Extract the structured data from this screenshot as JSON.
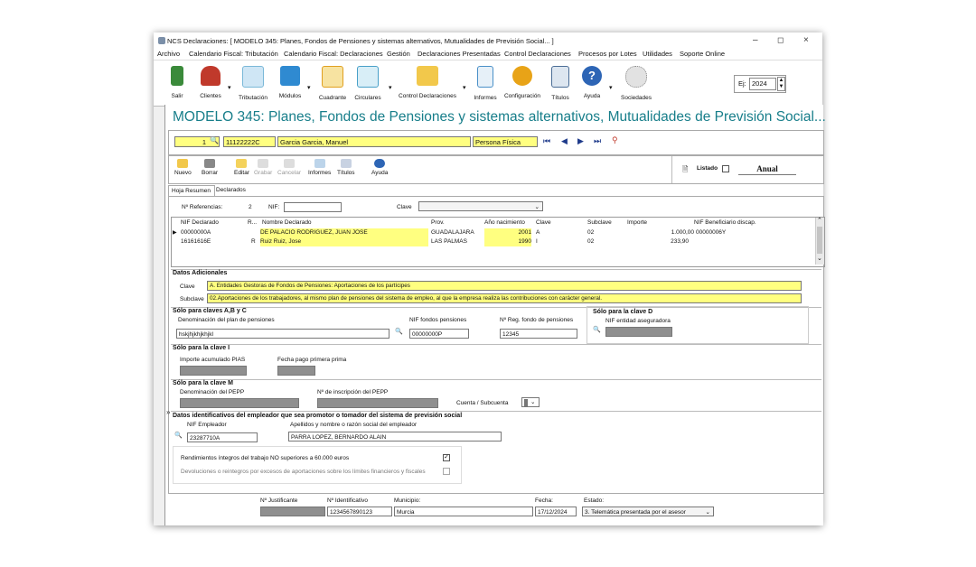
{
  "window": {
    "title": "NCS Declaraciones: [ MODELO 345: Planes, Fondos de Pensiones y sistemas alternativos, Mutualidades de Previsión Social... ]",
    "controls": [
      "–",
      "◻",
      "×"
    ]
  },
  "menu": [
    "Archivo",
    "Calendario Fiscal: Tributación",
    "Calendario Fiscal: Declaraciones",
    "Gestión",
    "Declaraciones Presentadas",
    "Control Declaraciones",
    "Procesos por Lotes",
    "Utilidades",
    "Soporte Online"
  ],
  "toolbar": {
    "items": [
      {
        "label": "Salir",
        "icon": "exit-icon",
        "color": "#3a8a3a"
      },
      {
        "label": "Clientes",
        "icon": "clients-icon",
        "color": "#c0392b"
      },
      {
        "label": "Tributación",
        "icon": "tax-icon",
        "color": "#7ab8d8"
      },
      {
        "label": "Módulos",
        "icon": "modules-icon",
        "color": "#2f8ad1"
      },
      {
        "label": "Cuadrante",
        "icon": "grid-icon",
        "color": "#e0a020"
      },
      {
        "label": "Circulares",
        "icon": "circulars-icon",
        "color": "#48a0c8"
      },
      {
        "label": "Control Declaraciones",
        "icon": "folder-icon",
        "color": "#f2c84b"
      },
      {
        "label": "Informes",
        "icon": "reports-icon",
        "color": "#4a90c8"
      },
      {
        "label": "Configuración",
        "icon": "gear-icon",
        "color": "#e8a317"
      },
      {
        "label": "Títulos",
        "icon": "titles-icon",
        "color": "#4b6d96"
      },
      {
        "label": "Ayuda",
        "icon": "help-icon",
        "color": "#2d65b5"
      },
      {
        "label": "Sociedades",
        "icon": "companies-icon",
        "color": "#888888"
      }
    ],
    "year_label": "Ej:",
    "year_value": "2024"
  },
  "heading": "MODELO 345: Planes, Fondos de Pensiones y sistemas alternativos, Mutualidades de Previsión Social...",
  "client": {
    "number": "1",
    "nif": "11122222C",
    "name": "Garcia Garcia, Manuel",
    "type": "Persona Física"
  },
  "subtoolbar": {
    "items": [
      "Nuevo",
      "Borrar",
      "Editar",
      "Grabar",
      "Cancelar",
      "Informes",
      "Títulos",
      "Ayuda"
    ],
    "listado_label": "Listado",
    "period": "Anual"
  },
  "tabs": [
    "Hoja Resumen",
    "Declarados"
  ],
  "filters": {
    "references_label": "Nº Referencias:",
    "references_count": "2",
    "nif_label": "NIF:",
    "clave_label": "Clave"
  },
  "table": {
    "headers": [
      "NIF Declarado",
      "R...",
      "Nombre Declarado",
      "Prov.",
      "Año nacimiento",
      "Clave",
      "Subclave",
      "Importe",
      "NIF Beneficiario discap."
    ],
    "rows": [
      {
        "nif": "00000000A",
        "r": "",
        "name": "DE PALACIO RODRIGUEZ, JUAN JOSE",
        "prov": "GUADALAJARA",
        "year": "2001",
        "clave": "A",
        "subclave": "02",
        "importe": "1.000,00",
        "nif_benef": "00000006Y"
      },
      {
        "nif": "16161616E",
        "r": "R",
        "name": "Ruiz Ruiz, Jose",
        "prov": "LAS PALMAS",
        "year": "1990",
        "clave": "I",
        "subclave": "02",
        "importe": "233,90",
        "nif_benef": ""
      }
    ]
  },
  "datos_adicionales": {
    "title": "Datos Adicionales",
    "clave_label": "Clave",
    "clave_value": "A. Entidades Gestoras de Fondos de Pensiones: Aportaciones de los partícipes",
    "subclave_label": "Subclave",
    "subclave_value": "02.Aportaciones de los trabajadores, al mismo plan de pensiones del sistema de empleo, al que la empresa realiza las contribuciones con carácter general."
  },
  "claves_abc": {
    "title": "Sólo para claves A,B y C",
    "plan_label": "Denominación del plan de pensiones",
    "plan_value": "hskjhjkhjkhjkl",
    "nif_fondos_label": "NIF fondos pensiones",
    "nif_fondos_value": "00000000P",
    "reg_label": "Nº Reg. fondo de pensiones",
    "reg_value": "12345"
  },
  "clave_d": {
    "title": "Sólo para la clave D",
    "nif_label": "NIF entidad aseguradora"
  },
  "clave_i": {
    "title": "Sólo para la clave I",
    "importe_label": "Importe acumulado PIAS",
    "fecha_label": "Fecha pago primera prima"
  },
  "clave_m": {
    "title": "Sólo para la clave M",
    "pepp_label": "Denominación del PEPP",
    "inscripcion_label": "Nº de inscripción del PEPP",
    "cuenta_label": "Cuenta / Subcuenta"
  },
  "empleador": {
    "title": "Datos identificativos del empleador que sea promotor  o tomador del sistema de previsión social",
    "nif_label": "NIF Empleador",
    "nif_value": "23287710A",
    "name_label": "Apellidos y nombre o razón social del empleador",
    "name_value": "PARRA LOPEZ, BERNARDO ALAIN"
  },
  "checks": {
    "rendimientos_label": "Rendimientos íntegros del trabajo NO superiores a 60.000 euros",
    "rendimientos_checked": true,
    "devoluciones_label": "Devoluciones o reintegros por excesos de aportaciones sobre los límites financieros y fiscales",
    "devoluciones_checked": false
  },
  "footer": {
    "justificante_label": "Nº Justificante",
    "identificativo_label": "Nº Identificativo",
    "identificativo_value": "1234567890123",
    "municipio_label": "Municipio:",
    "municipio_value": "Murcia",
    "fecha_label": "Fecha:",
    "fecha_value": "17/12/2024",
    "estado_label": "Estado:",
    "estado_value": "3. Telemática presentada por el asesor"
  },
  "colors": {
    "heading": "#177e8a",
    "highlight": "#ffff80",
    "disabled_field": "#8f8f8f"
  }
}
